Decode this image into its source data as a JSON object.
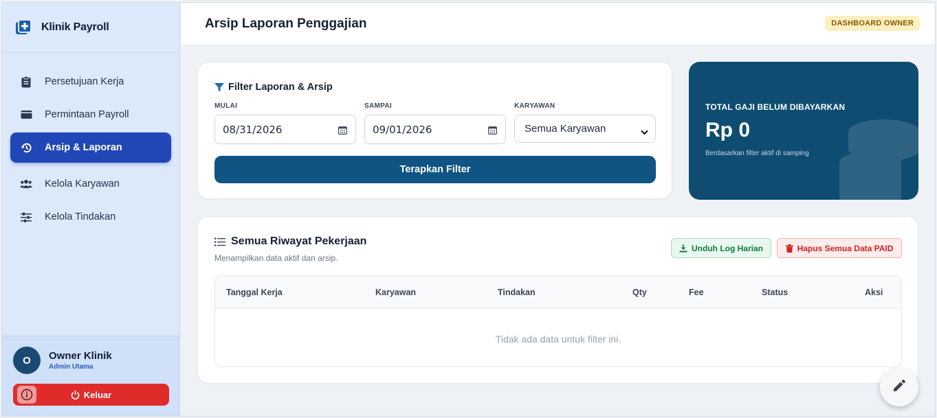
{
  "brand": {
    "name": "Klinik Payroll",
    "icon": "medical-plus-icon"
  },
  "sidebar": {
    "items": [
      {
        "label": "Persetujuan Kerja",
        "icon": "clipboard-icon"
      },
      {
        "label": "Permintaan Payroll",
        "icon": "wallet-icon"
      },
      {
        "label": "Arsip & Laporan",
        "icon": "history-icon",
        "active": true
      },
      {
        "label": "Kelola Karyawan",
        "icon": "users-icon"
      },
      {
        "label": "Kelola Tindakan",
        "icon": "sliders-icon"
      }
    ]
  },
  "user": {
    "initial": "O",
    "name": "Owner Klinik",
    "role": "Admin Utama"
  },
  "logout": {
    "label": "Keluar"
  },
  "header": {
    "title": "Arsip Laporan Penggajian",
    "badge": "DASHBOARD OWNER"
  },
  "filter": {
    "title": "Filter Laporan & Arsip",
    "start": {
      "label": "MULAI",
      "value": "08/31/2026"
    },
    "end": {
      "label": "SAMPAI",
      "value": "09/01/2026"
    },
    "employee": {
      "label": "KARYAWAN",
      "value": "Semua Karyawan"
    },
    "apply_label": "Terapkan Filter"
  },
  "stat": {
    "label": "TOTAL GAJI BELUM DIBAYARKAN",
    "value": "Rp 0",
    "sub": "Berdasarkan filter aktif di samping"
  },
  "history": {
    "title": "Semua Riwayat Pekerjaan",
    "subtitle": "Menampilkan data aktif dan arsip.",
    "download_label": "Unduh Log Harian",
    "delete_label": "Hapus Semua Data PAID",
    "columns": [
      "Tanggal Kerja",
      "Karyawan",
      "Tindakan",
      "Qty",
      "Fee",
      "Status",
      "Aksi"
    ],
    "empty": "Tidak ada data untuk filter ini."
  },
  "colors": {
    "primary": "#0f5483",
    "active_nav": "#2147b6",
    "danger": "#e02b2b",
    "success": "#137a44"
  }
}
